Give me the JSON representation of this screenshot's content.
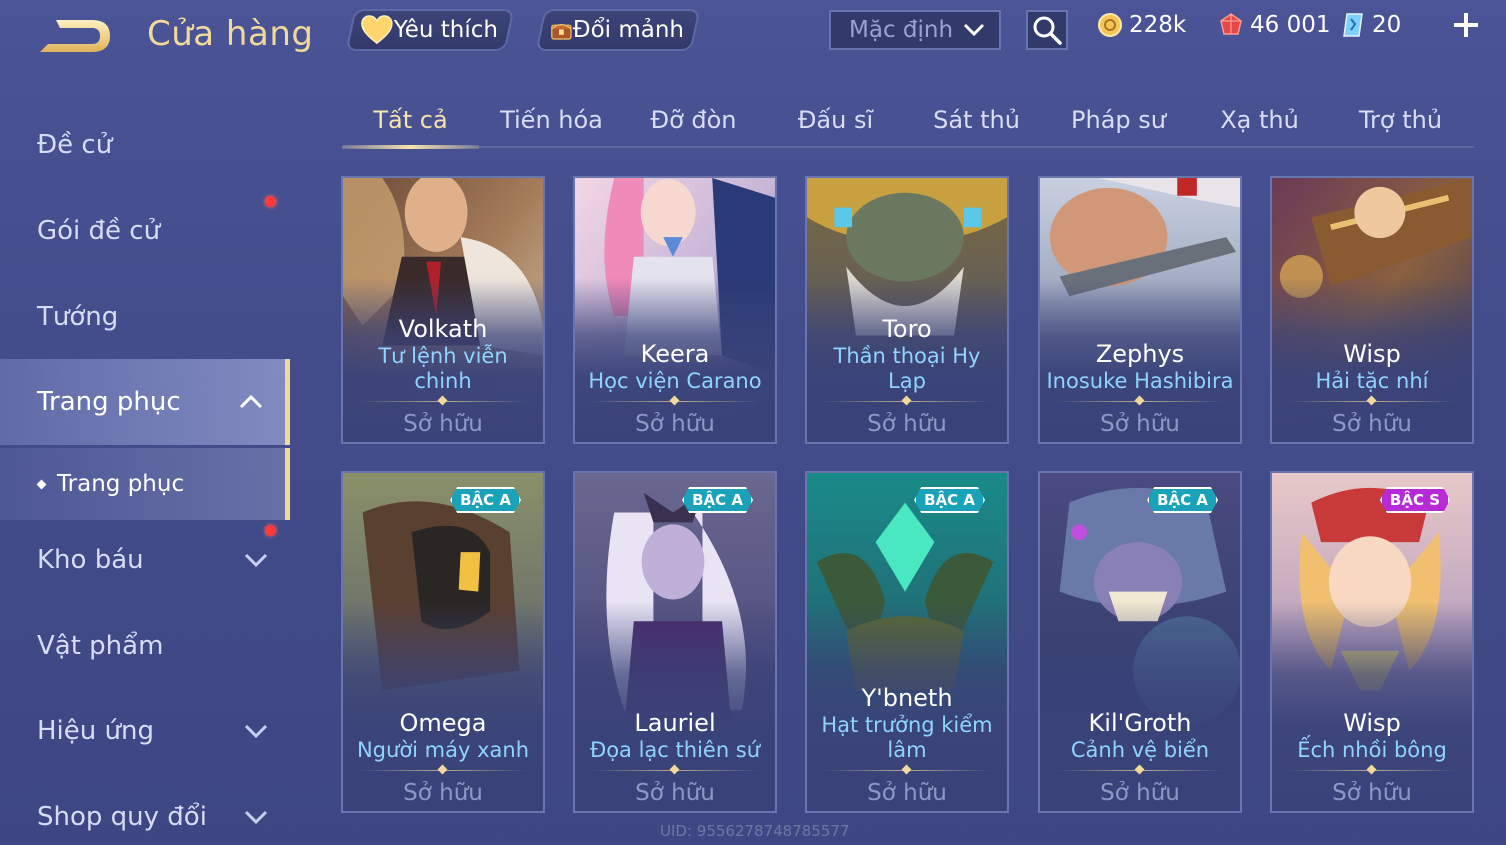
{
  "header": {
    "title": "Cửa hàng",
    "favorites_label": "Yêu thích",
    "exchange_label": "Đổi mảnh",
    "sort_value": "Mặc định"
  },
  "currency": {
    "gold": "228k",
    "voucher": "46 001",
    "gem": "20"
  },
  "sidebar": {
    "items": [
      {
        "label": "Đề cử"
      },
      {
        "label": "Gói đề cử"
      },
      {
        "label": "Tướng"
      },
      {
        "label": "Trang phục"
      },
      {
        "label": "Trang phục"
      },
      {
        "label": "Kho báu"
      },
      {
        "label": "Vật phẩm"
      },
      {
        "label": "Hiệu ứng"
      },
      {
        "label": "Shop quy đổi"
      }
    ]
  },
  "tabs": [
    "Tất cả",
    "Tiến hóa",
    "Đỡ đòn",
    "Đấu sĩ",
    "Sát thủ",
    "Pháp sư",
    "Xạ thủ",
    "Trợ thủ"
  ],
  "cards": [
    {
      "hero": "Volkath",
      "skin": "Tư lệnh viễn chinh",
      "status": "Sở hữu",
      "tier": ""
    },
    {
      "hero": "Keera",
      "skin": "Học viện Carano",
      "status": "Sở hữu",
      "tier": ""
    },
    {
      "hero": "Toro",
      "skin": "Thần thoại Hy Lạp",
      "status": "Sở hữu",
      "tier": ""
    },
    {
      "hero": "Zephys",
      "skin": "Inosuke Hashibira",
      "status": "Sở hữu",
      "tier": ""
    },
    {
      "hero": "Wisp",
      "skin": "Hải tặc nhí",
      "status": "Sở hữu",
      "tier": ""
    },
    {
      "hero": "Omega",
      "skin": "Người máy xanh",
      "status": "Sở hữu",
      "tier": "BẬC A"
    },
    {
      "hero": "Lauriel",
      "skin": "Đọa lạc thiên sứ",
      "status": "Sở hữu",
      "tier": "BẬC A"
    },
    {
      "hero": "Y'bneth",
      "skin": "Hạt trưởng kiểm lâm",
      "status": "Sở hữu",
      "tier": "BẬC A"
    },
    {
      "hero": "Kil'Groth",
      "skin": "Cảnh vệ biển",
      "status": "Sở hữu",
      "tier": "BẬC A"
    },
    {
      "hero": "Wisp",
      "skin": "Ếch nhồi bông",
      "status": "Sở hữu",
      "tier": "BẬC S"
    }
  ],
  "footer": {
    "uid": "UID: 9556278748785577"
  },
  "colors": {
    "accent_gold": "#f0d99a",
    "skin_name_blue": "#8fd4ff",
    "tier_a": "#1aa3b8",
    "tier_s": "#b62bd6",
    "notification_red": "#ff3a3a"
  }
}
